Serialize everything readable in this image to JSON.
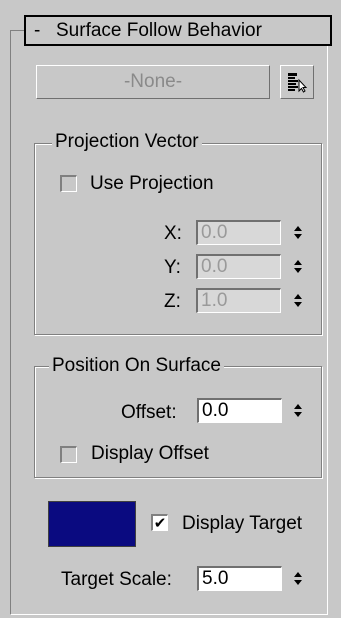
{
  "rollout": {
    "toggle_symbol": "-",
    "title": "Surface Follow Behavior"
  },
  "surface_button": {
    "label": "-None-"
  },
  "pick_icon": "pick-list-icon",
  "projection": {
    "group_title": "Projection Vector",
    "use_projection_label": "Use Projection",
    "use_projection_checked": false,
    "x": {
      "label": "X:",
      "value": "0.0"
    },
    "y": {
      "label": "Y:",
      "value": "0.0"
    },
    "z": {
      "label": "Z:",
      "value": "1.0"
    }
  },
  "position": {
    "group_title": "Position On Surface",
    "offset_label": "Offset:",
    "offset_value": "0.0",
    "display_offset_label": "Display Offset",
    "display_offset_checked": false
  },
  "target": {
    "color": "#0a0a80",
    "display_target_label": "Display Target",
    "display_target_checked": true,
    "check_mark": "✔",
    "scale_label": "Target Scale:",
    "scale_value": "5.0"
  }
}
